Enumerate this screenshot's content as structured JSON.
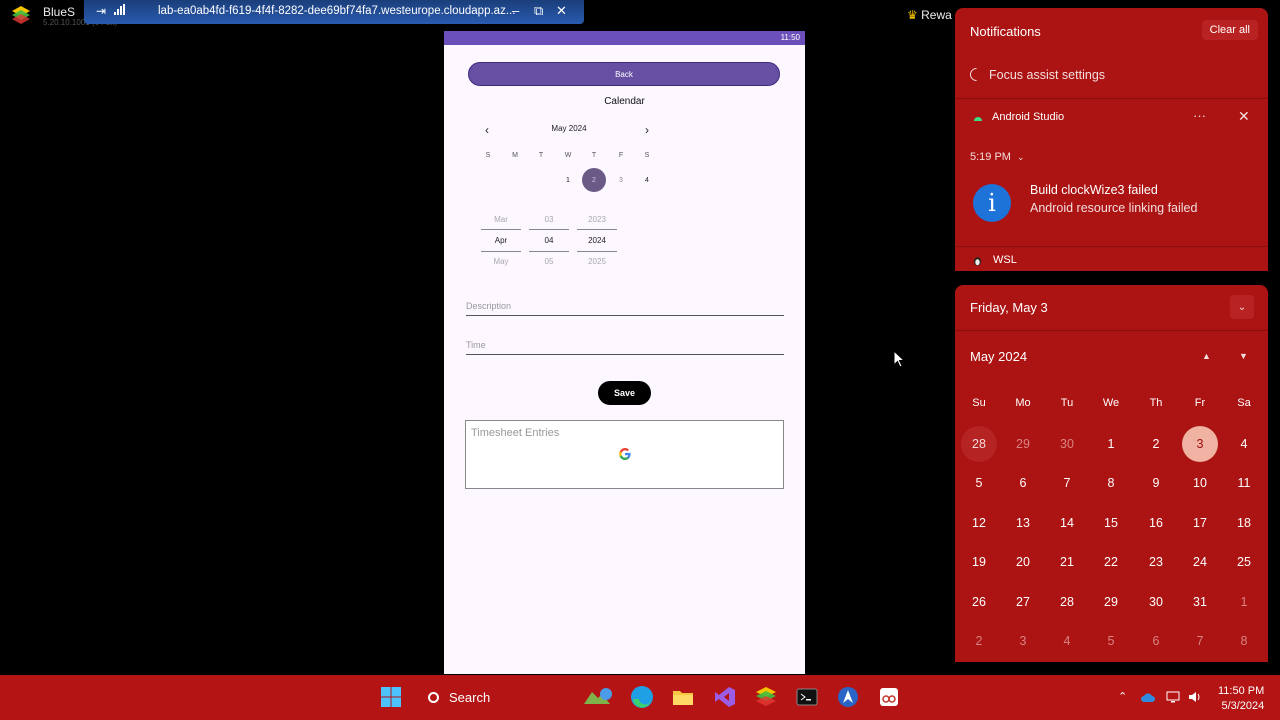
{
  "remote_window": {
    "app_title": "BlueS",
    "app_version": "5.20.10.1001 (64-bit)",
    "host": "lab-ea0ab4fd-f619-4f4f-8282-dee69bf74fa7.westeurope.cloudapp.az...",
    "minimize": "–",
    "restore": "⧉",
    "close": "✕",
    "pin": "⇥",
    "signal": "📶",
    "rewards": "Rewa"
  },
  "phone": {
    "status_time": "11:50",
    "back_label": "Back",
    "calendar_title": "Calendar",
    "month_label": "May 2024",
    "prev": "‹",
    "next": "›",
    "weekdays": [
      "S",
      "M",
      "T",
      "W",
      "T",
      "F",
      "S"
    ],
    "days": [
      {
        "label": "1",
        "state": "normal"
      },
      {
        "label": "2",
        "state": "selected"
      },
      {
        "label": "3",
        "state": "faded"
      },
      {
        "label": "4",
        "state": "normal"
      }
    ],
    "wheel": {
      "month": [
        "Mar",
        "Apr",
        "May"
      ],
      "day": [
        "03",
        "04",
        "05"
      ],
      "year": [
        "2023",
        "2024",
        "2025"
      ]
    },
    "description_placeholder": "Description",
    "time_placeholder": "Time",
    "save_label": "Save",
    "entries_placeholder": "Timesheet Entries"
  },
  "notifications": {
    "title": "Notifications",
    "clear_all": "Clear all",
    "focus_assist": "Focus assist settings",
    "app_name": "Android Studio",
    "more": "···",
    "close": "✕",
    "time": "5:19 PM",
    "chevron": "⌄",
    "info_glyph": "i",
    "heading": "Build clockWize3 failed",
    "body": "Android resource linking failed",
    "wsl": "WSL"
  },
  "calendar": {
    "date_header": "Friday, May 3",
    "collapse": "⌄",
    "month": "May 2024",
    "up": "▲",
    "down": "▼",
    "dow": [
      "Su",
      "Mo",
      "Tu",
      "We",
      "Th",
      "Fr",
      "Sa"
    ],
    "weeks": [
      [
        {
          "d": "28",
          "s": "hover"
        },
        {
          "d": "29",
          "s": "other"
        },
        {
          "d": "30",
          "s": "other"
        },
        {
          "d": "1",
          "s": ""
        },
        {
          "d": "2",
          "s": ""
        },
        {
          "d": "3",
          "s": "today"
        },
        {
          "d": "4",
          "s": ""
        }
      ],
      [
        {
          "d": "5",
          "s": ""
        },
        {
          "d": "6",
          "s": ""
        },
        {
          "d": "7",
          "s": ""
        },
        {
          "d": "8",
          "s": ""
        },
        {
          "d": "9",
          "s": ""
        },
        {
          "d": "10",
          "s": ""
        },
        {
          "d": "11",
          "s": ""
        }
      ],
      [
        {
          "d": "12",
          "s": ""
        },
        {
          "d": "13",
          "s": ""
        },
        {
          "d": "14",
          "s": ""
        },
        {
          "d": "15",
          "s": ""
        },
        {
          "d": "16",
          "s": ""
        },
        {
          "d": "17",
          "s": ""
        },
        {
          "d": "18",
          "s": ""
        }
      ],
      [
        {
          "d": "19",
          "s": ""
        },
        {
          "d": "20",
          "s": ""
        },
        {
          "d": "21",
          "s": ""
        },
        {
          "d": "22",
          "s": ""
        },
        {
          "d": "23",
          "s": ""
        },
        {
          "d": "24",
          "s": ""
        },
        {
          "d": "25",
          "s": ""
        }
      ],
      [
        {
          "d": "26",
          "s": ""
        },
        {
          "d": "27",
          "s": ""
        },
        {
          "d": "28",
          "s": ""
        },
        {
          "d": "29",
          "s": ""
        },
        {
          "d": "30",
          "s": ""
        },
        {
          "d": "31",
          "s": ""
        },
        {
          "d": "1",
          "s": "other"
        }
      ],
      [
        {
          "d": "2",
          "s": "other"
        },
        {
          "d": "3",
          "s": "other"
        },
        {
          "d": "4",
          "s": "other"
        },
        {
          "d": "5",
          "s": "other"
        },
        {
          "d": "6",
          "s": "other"
        },
        {
          "d": "7",
          "s": "other"
        },
        {
          "d": "8",
          "s": "other"
        }
      ]
    ]
  },
  "taskbar": {
    "search_label": "Search",
    "time": "11:50 PM",
    "date": "5/3/2024",
    "tray_up": "⌃",
    "icons": [
      "windows-icon",
      "widgets-icon",
      "edge-icon",
      "file-explorer-icon",
      "visual-studio-icon",
      "bluestacks-icon",
      "terminal-icon",
      "android-studio-icon",
      "snipping-tool-icon"
    ]
  },
  "colors": {
    "accent_red": "#ac1313",
    "taskbar_red": "#b41414",
    "phone_purple": "#6750a4",
    "today_circle": "#f0b3a3",
    "info_blue": "#1e73d8"
  }
}
